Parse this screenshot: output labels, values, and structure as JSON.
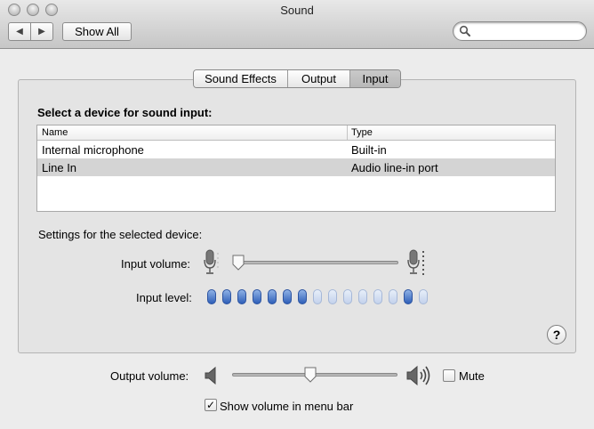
{
  "window": {
    "title": "Sound"
  },
  "toolbar": {
    "back_label": "◀",
    "forward_label": "▶",
    "show_all_label": "Show All",
    "search_placeholder": "",
    "search_value": ""
  },
  "tabs": [
    {
      "label": "Sound Effects",
      "active": false
    },
    {
      "label": "Output",
      "active": false
    },
    {
      "label": "Input",
      "active": true
    }
  ],
  "input": {
    "heading": "Select a device for sound input:",
    "columns": {
      "name": "Name",
      "type": "Type"
    },
    "devices": [
      {
        "name": "Internal microphone",
        "type": "Built-in",
        "selected": false
      },
      {
        "name": "Line In",
        "type": "Audio line-in port",
        "selected": true
      }
    ],
    "settings_label": "Settings for the selected device:",
    "input_volume_label": "Input volume:",
    "input_volume_level": 0.0,
    "input_level_label": "Input level:",
    "input_level_bars": [
      1,
      1,
      1,
      1,
      1,
      1,
      1,
      0,
      0,
      0,
      0,
      0,
      0,
      1,
      0
    ],
    "help_label": "?"
  },
  "output": {
    "volume_label": "Output volume:",
    "volume_level": 0.47,
    "mute_label": "Mute",
    "mute_checked": false,
    "menu_bar_label": "Show volume in menu bar",
    "menu_bar_checked": true
  },
  "colors": {
    "level_on": "#2e5fb8",
    "level_off": "#c3d2ec"
  }
}
